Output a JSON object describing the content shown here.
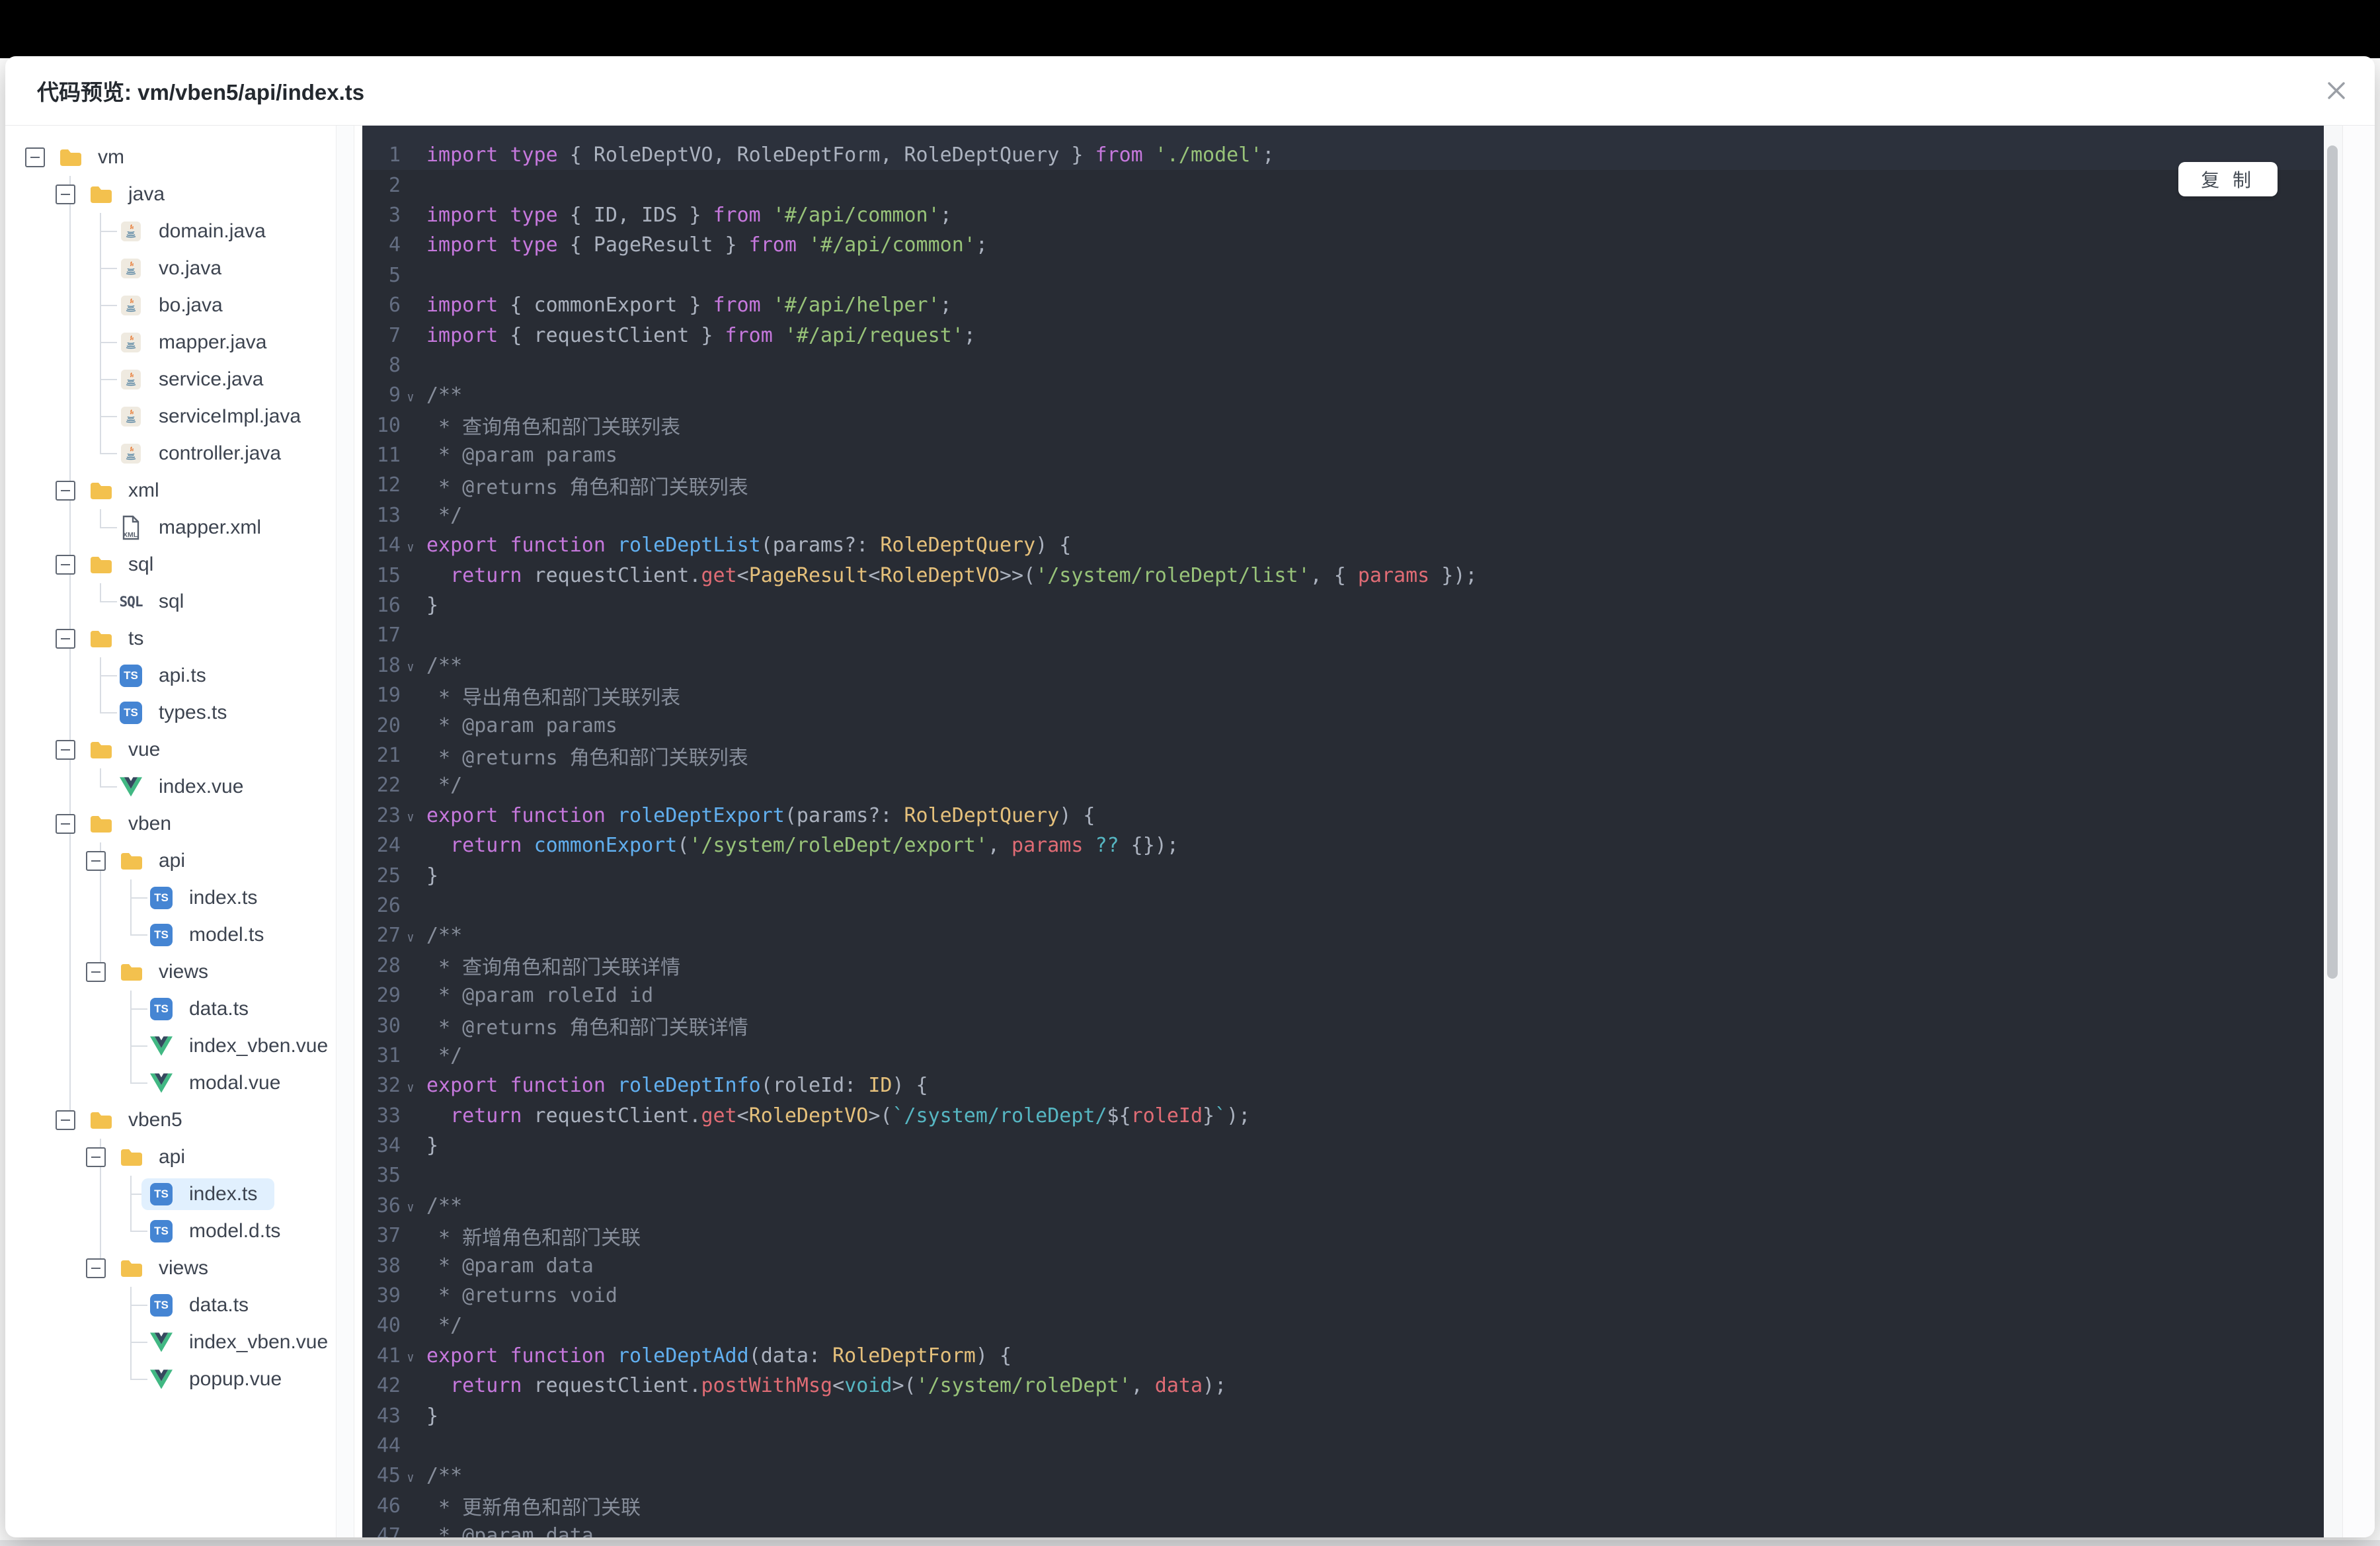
{
  "window": {
    "title": "代码预览: vm/vben5/api/index.ts",
    "close_icon": "x-close"
  },
  "copy_button": {
    "label": "复 制"
  },
  "colors": {
    "code-bg": "#282c34",
    "code-activeline": "#2c313c",
    "linenum": "#646e82",
    "syn-keyword": "#c678dd",
    "syn-string": "#98c379",
    "syn-type": "#e5c07b",
    "syn-func": "#61afef",
    "syn-prop": "#e06c75",
    "syn-cyan": "#56b6c2",
    "syn-comment": "#878e9b",
    "syn-plain": "#abb2bf",
    "tree-selected-bg": "#e1f0fe",
    "folder-icon": "#f3c14e",
    "ts-badge": "#4585d3",
    "vue-green": "#41b883",
    "vue-dark": "#35495e",
    "java-orange": "#e8762d",
    "java-blue": "#5382a1"
  },
  "tree": {
    "root": {
      "label": "vm",
      "type": "folder",
      "children": [
        {
          "label": "java",
          "type": "folder",
          "children": [
            {
              "label": "domain.java",
              "type": "java"
            },
            {
              "label": "vo.java",
              "type": "java"
            },
            {
              "label": "bo.java",
              "type": "java"
            },
            {
              "label": "mapper.java",
              "type": "java"
            },
            {
              "label": "service.java",
              "type": "java"
            },
            {
              "label": "serviceImpl.java",
              "type": "java"
            },
            {
              "label": "controller.java",
              "type": "java"
            }
          ]
        },
        {
          "label": "xml",
          "type": "folder",
          "children": [
            {
              "label": "mapper.xml",
              "type": "xml"
            }
          ]
        },
        {
          "label": "sql",
          "type": "folder",
          "children": [
            {
              "label": "sql",
              "type": "sql"
            }
          ]
        },
        {
          "label": "ts",
          "type": "folder",
          "children": [
            {
              "label": "api.ts",
              "type": "ts"
            },
            {
              "label": "types.ts",
              "type": "ts"
            }
          ]
        },
        {
          "label": "vue",
          "type": "folder",
          "children": [
            {
              "label": "index.vue",
              "type": "vue"
            }
          ]
        },
        {
          "label": "vben",
          "type": "folder",
          "children": [
            {
              "label": "api",
              "type": "folder",
              "children": [
                {
                  "label": "index.ts",
                  "type": "ts"
                },
                {
                  "label": "model.ts",
                  "type": "ts"
                }
              ]
            },
            {
              "label": "views",
              "type": "folder",
              "children": [
                {
                  "label": "data.ts",
                  "type": "ts"
                },
                {
                  "label": "index_vben.vue",
                  "type": "vue"
                },
                {
                  "label": "modal.vue",
                  "type": "vue"
                }
              ]
            }
          ]
        },
        {
          "label": "vben5",
          "type": "folder",
          "children": [
            {
              "label": "api",
              "type": "folder",
              "children": [
                {
                  "label": "index.ts",
                  "type": "ts",
                  "selected": true
                },
                {
                  "label": "model.d.ts",
                  "type": "ts"
                }
              ]
            },
            {
              "label": "views",
              "type": "folder",
              "children": [
                {
                  "label": "data.ts",
                  "type": "ts"
                },
                {
                  "label": "index_vben.vue",
                  "type": "vue"
                },
                {
                  "label": "popup.vue",
                  "type": "vue"
                }
              ]
            }
          ]
        }
      ]
    }
  },
  "code": {
    "language": "typescript",
    "lines": [
      {
        "n": 1,
        "f": false,
        "t": [
          [
            "k",
            "import"
          ],
          [
            "p",
            " "
          ],
          [
            "k",
            "type"
          ],
          [
            "p",
            " { RoleDeptVO, RoleDeptForm, RoleDeptQuery } "
          ],
          [
            "k",
            "from"
          ],
          [
            "p",
            " "
          ],
          [
            "s",
            "'./model'"
          ],
          [
            "p",
            ";"
          ]
        ]
      },
      {
        "n": 2,
        "f": false,
        "t": []
      },
      {
        "n": 3,
        "f": false,
        "t": [
          [
            "k",
            "import"
          ],
          [
            "p",
            " "
          ],
          [
            "k",
            "type"
          ],
          [
            "p",
            " { ID, IDS } "
          ],
          [
            "k",
            "from"
          ],
          [
            "p",
            " "
          ],
          [
            "s",
            "'#/api/common'"
          ],
          [
            "p",
            ";"
          ]
        ]
      },
      {
        "n": 4,
        "f": false,
        "t": [
          [
            "k",
            "import"
          ],
          [
            "p",
            " "
          ],
          [
            "k",
            "type"
          ],
          [
            "p",
            " { PageResult } "
          ],
          [
            "k",
            "from"
          ],
          [
            "p",
            " "
          ],
          [
            "s",
            "'#/api/common'"
          ],
          [
            "p",
            ";"
          ]
        ]
      },
      {
        "n": 5,
        "f": false,
        "t": []
      },
      {
        "n": 6,
        "f": false,
        "t": [
          [
            "k",
            "import"
          ],
          [
            "p",
            " { commonExport } "
          ],
          [
            "k",
            "from"
          ],
          [
            "p",
            " "
          ],
          [
            "s",
            "'#/api/helper'"
          ],
          [
            "p",
            ";"
          ]
        ]
      },
      {
        "n": 7,
        "f": false,
        "t": [
          [
            "k",
            "import"
          ],
          [
            "p",
            " { requestClient } "
          ],
          [
            "k",
            "from"
          ],
          [
            "p",
            " "
          ],
          [
            "s",
            "'#/api/request'"
          ],
          [
            "p",
            ";"
          ]
        ]
      },
      {
        "n": 8,
        "f": false,
        "t": []
      },
      {
        "n": 9,
        "f": true,
        "t": [
          [
            "c",
            "/**"
          ]
        ]
      },
      {
        "n": 10,
        "f": false,
        "t": [
          [
            "c",
            " * 查询角色和部门关联列表"
          ]
        ]
      },
      {
        "n": 11,
        "f": false,
        "t": [
          [
            "c",
            " * @param params"
          ]
        ]
      },
      {
        "n": 12,
        "f": false,
        "t": [
          [
            "c",
            " * @returns 角色和部门关联列表"
          ]
        ]
      },
      {
        "n": 13,
        "f": false,
        "t": [
          [
            "c",
            " */"
          ]
        ]
      },
      {
        "n": 14,
        "f": true,
        "t": [
          [
            "k",
            "export"
          ],
          [
            "p",
            " "
          ],
          [
            "k",
            "function"
          ],
          [
            "p",
            " "
          ],
          [
            "f",
            "roleDeptList"
          ],
          [
            "p",
            "(params?: "
          ],
          [
            "t",
            "RoleDeptQuery"
          ],
          [
            "p",
            ") {"
          ]
        ]
      },
      {
        "n": 15,
        "f": false,
        "t": [
          [
            "p",
            "  "
          ],
          [
            "k",
            "return"
          ],
          [
            "p",
            " requestClient."
          ],
          [
            "r",
            "get"
          ],
          [
            "p",
            "<"
          ],
          [
            "t",
            "PageResult"
          ],
          [
            "p",
            "<"
          ],
          [
            "t",
            "RoleDeptVO"
          ],
          [
            "p",
            ">>("
          ],
          [
            "s",
            "'/system/roleDept/list'"
          ],
          [
            "p",
            ", { "
          ],
          [
            "r",
            "params"
          ],
          [
            "p",
            " });"
          ]
        ]
      },
      {
        "n": 16,
        "f": false,
        "t": [
          [
            "p",
            "}"
          ]
        ]
      },
      {
        "n": 17,
        "f": false,
        "t": []
      },
      {
        "n": 18,
        "f": true,
        "t": [
          [
            "c",
            "/**"
          ]
        ]
      },
      {
        "n": 19,
        "f": false,
        "t": [
          [
            "c",
            " * 导出角色和部门关联列表"
          ]
        ]
      },
      {
        "n": 20,
        "f": false,
        "t": [
          [
            "c",
            " * @param params"
          ]
        ]
      },
      {
        "n": 21,
        "f": false,
        "t": [
          [
            "c",
            " * @returns 角色和部门关联列表"
          ]
        ]
      },
      {
        "n": 22,
        "f": false,
        "t": [
          [
            "c",
            " */"
          ]
        ]
      },
      {
        "n": 23,
        "f": true,
        "t": [
          [
            "k",
            "export"
          ],
          [
            "p",
            " "
          ],
          [
            "k",
            "function"
          ],
          [
            "p",
            " "
          ],
          [
            "f",
            "roleDeptExport"
          ],
          [
            "p",
            "(params?: "
          ],
          [
            "t",
            "RoleDeptQuery"
          ],
          [
            "p",
            ") {"
          ]
        ]
      },
      {
        "n": 24,
        "f": false,
        "t": [
          [
            "p",
            "  "
          ],
          [
            "k",
            "return"
          ],
          [
            "p",
            " "
          ],
          [
            "f",
            "commonExport"
          ],
          [
            "p",
            "("
          ],
          [
            "s",
            "'/system/roleDept/export'"
          ],
          [
            "p",
            ", "
          ],
          [
            "r",
            "params"
          ],
          [
            "p",
            " "
          ],
          [
            "y",
            "??"
          ],
          [
            "p",
            " {});"
          ]
        ]
      },
      {
        "n": 25,
        "f": false,
        "t": [
          [
            "p",
            "}"
          ]
        ]
      },
      {
        "n": 26,
        "f": false,
        "t": []
      },
      {
        "n": 27,
        "f": true,
        "t": [
          [
            "c",
            "/**"
          ]
        ]
      },
      {
        "n": 28,
        "f": false,
        "t": [
          [
            "c",
            " * 查询角色和部门关联详情"
          ]
        ]
      },
      {
        "n": 29,
        "f": false,
        "t": [
          [
            "c",
            " * @param roleId id"
          ]
        ]
      },
      {
        "n": 30,
        "f": false,
        "t": [
          [
            "c",
            " * @returns 角色和部门关联详情"
          ]
        ]
      },
      {
        "n": 31,
        "f": false,
        "t": [
          [
            "c",
            " */"
          ]
        ]
      },
      {
        "n": 32,
        "f": true,
        "t": [
          [
            "k",
            "export"
          ],
          [
            "p",
            " "
          ],
          [
            "k",
            "function"
          ],
          [
            "p",
            " "
          ],
          [
            "f",
            "roleDeptInfo"
          ],
          [
            "p",
            "(roleId: "
          ],
          [
            "t",
            "ID"
          ],
          [
            "p",
            ") {"
          ]
        ]
      },
      {
        "n": 33,
        "f": false,
        "t": [
          [
            "p",
            "  "
          ],
          [
            "k",
            "return"
          ],
          [
            "p",
            " requestClient."
          ],
          [
            "r",
            "get"
          ],
          [
            "p",
            "<"
          ],
          [
            "t",
            "RoleDeptVO"
          ],
          [
            "p",
            ">("
          ],
          [
            "y",
            "`/system/roleDept/"
          ],
          [
            "p",
            "${"
          ],
          [
            "r",
            "roleId"
          ],
          [
            "p",
            "}"
          ],
          [
            "y",
            "`"
          ],
          [
            "p",
            ");"
          ]
        ]
      },
      {
        "n": 34,
        "f": false,
        "t": [
          [
            "p",
            "}"
          ]
        ]
      },
      {
        "n": 35,
        "f": false,
        "t": []
      },
      {
        "n": 36,
        "f": true,
        "t": [
          [
            "c",
            "/**"
          ]
        ]
      },
      {
        "n": 37,
        "f": false,
        "t": [
          [
            "c",
            " * 新增角色和部门关联"
          ]
        ]
      },
      {
        "n": 38,
        "f": false,
        "t": [
          [
            "c",
            " * @param data"
          ]
        ]
      },
      {
        "n": 39,
        "f": false,
        "t": [
          [
            "c",
            " * @returns void"
          ]
        ]
      },
      {
        "n": 40,
        "f": false,
        "t": [
          [
            "c",
            " */"
          ]
        ]
      },
      {
        "n": 41,
        "f": true,
        "t": [
          [
            "k",
            "export"
          ],
          [
            "p",
            " "
          ],
          [
            "k",
            "function"
          ],
          [
            "p",
            " "
          ],
          [
            "f",
            "roleDeptAdd"
          ],
          [
            "p",
            "(data: "
          ],
          [
            "t",
            "RoleDeptForm"
          ],
          [
            "p",
            ") {"
          ]
        ]
      },
      {
        "n": 42,
        "f": false,
        "t": [
          [
            "p",
            "  "
          ],
          [
            "k",
            "return"
          ],
          [
            "p",
            " requestClient."
          ],
          [
            "r",
            "postWithMsg"
          ],
          [
            "p",
            "<"
          ],
          [
            "y",
            "void"
          ],
          [
            "p",
            ">("
          ],
          [
            "s",
            "'/system/roleDept'"
          ],
          [
            "p",
            ", "
          ],
          [
            "r",
            "data"
          ],
          [
            "p",
            ");"
          ]
        ]
      },
      {
        "n": 43,
        "f": false,
        "t": [
          [
            "p",
            "}"
          ]
        ]
      },
      {
        "n": 44,
        "f": false,
        "t": []
      },
      {
        "n": 45,
        "f": true,
        "t": [
          [
            "c",
            "/**"
          ]
        ]
      },
      {
        "n": 46,
        "f": false,
        "t": [
          [
            "c",
            " * 更新角色和部门关联"
          ]
        ]
      },
      {
        "n": 47,
        "f": false,
        "t": [
          [
            "c",
            " * @param data"
          ]
        ]
      }
    ]
  }
}
